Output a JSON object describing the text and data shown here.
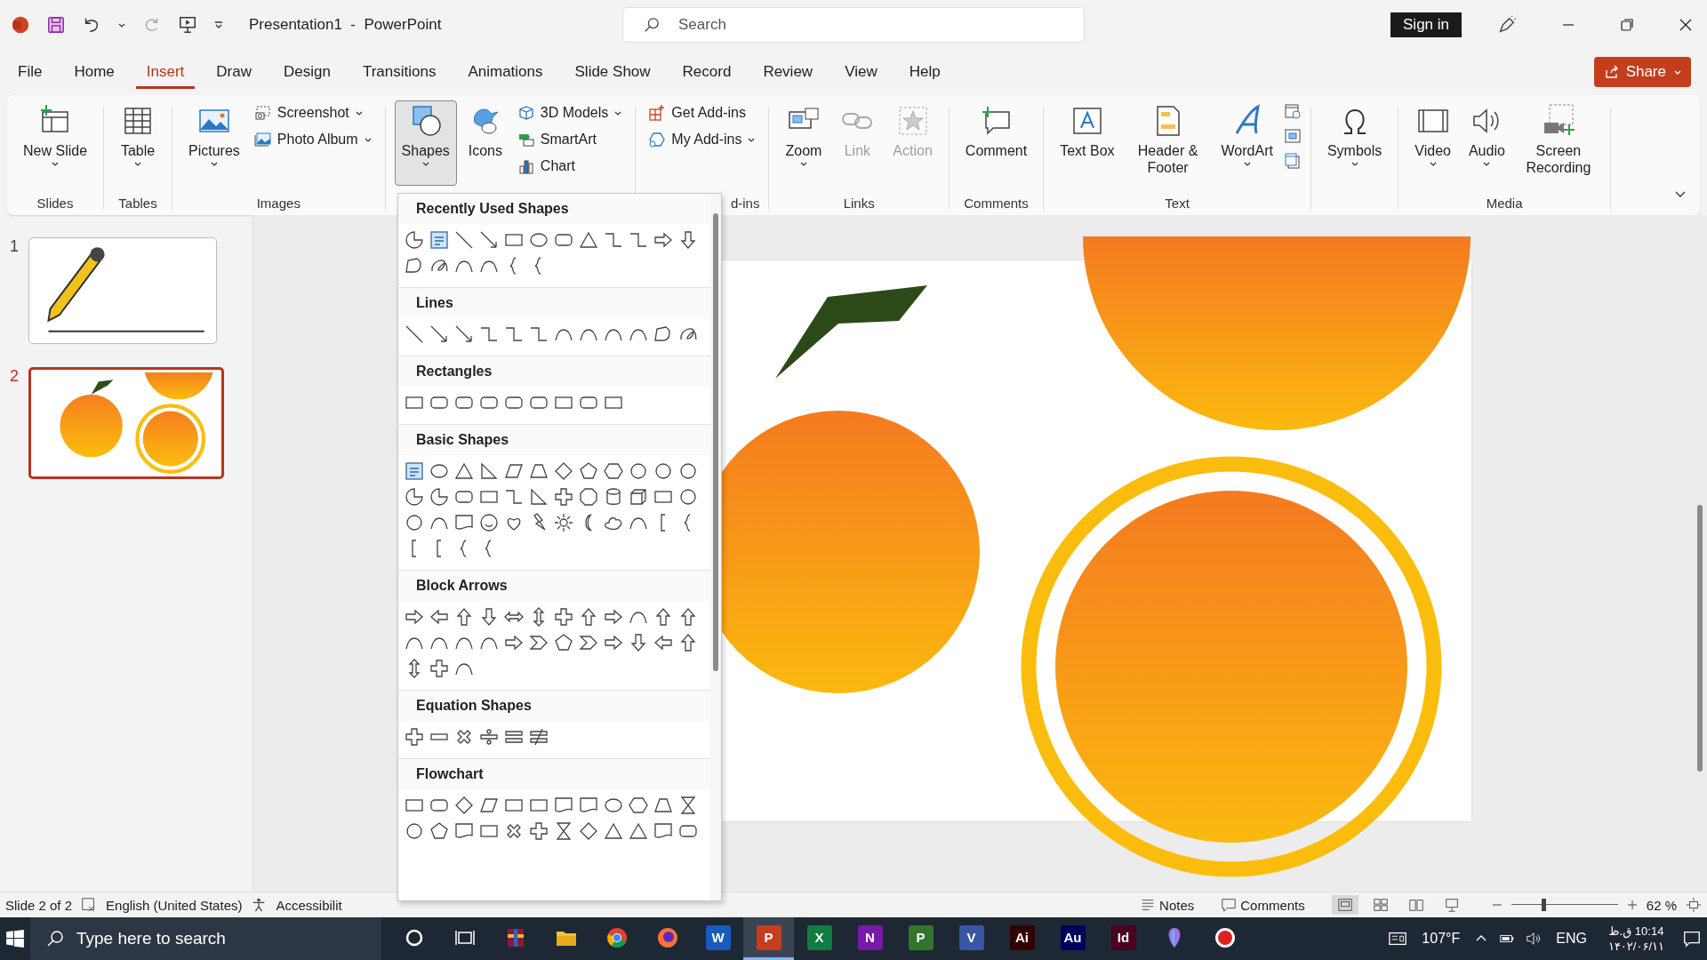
{
  "title_bar": {
    "title": "Presentation1  -  PowerPoint",
    "search_placeholder": "Search",
    "sign_in": "Sign in"
  },
  "tabs": [
    {
      "label": "File",
      "selected": false
    },
    {
      "label": "Home",
      "selected": false
    },
    {
      "label": "Insert",
      "selected": true
    },
    {
      "label": "Draw",
      "selected": false
    },
    {
      "label": "Design",
      "selected": false
    },
    {
      "label": "Transitions",
      "selected": false
    },
    {
      "label": "Animations",
      "selected": false
    },
    {
      "label": "Slide Show",
      "selected": false
    },
    {
      "label": "Record",
      "selected": false
    },
    {
      "label": "Review",
      "selected": false
    },
    {
      "label": "View",
      "selected": false
    },
    {
      "label": "Help",
      "selected": false
    }
  ],
  "share": "Share",
  "ribbon": {
    "groups": [
      {
        "label": "Slides",
        "items": [
          {
            "kind": "large",
            "label": "New Slide",
            "dropdown": true,
            "disabled": false,
            "expanded": false
          }
        ]
      },
      {
        "label": "Tables",
        "items": [
          {
            "kind": "large",
            "label": "Table",
            "dropdown": true,
            "disabled": false,
            "expanded": false
          }
        ]
      },
      {
        "label": "Images",
        "items": [
          {
            "kind": "large",
            "label": "Pictures",
            "dropdown": true,
            "disabled": false,
            "expanded": false
          },
          {
            "kind": "stack",
            "items": [
              {
                "label": "Screenshot",
                "dropdown": true
              },
              {
                "label": "Photo Album",
                "dropdown": true
              }
            ]
          }
        ]
      },
      {
        "items": [
          {
            "kind": "large",
            "label": "Shapes",
            "dropdown": true,
            "disabled": false,
            "expanded": true
          },
          {
            "kind": "large",
            "label": "Icons",
            "dropdown": false,
            "disabled": false,
            "expanded": false
          },
          {
            "kind": "stack",
            "items": [
              {
                "label": "3D Models",
                "dropdown": true
              },
              {
                "label": "SmartArt",
                "dropdown": false
              },
              {
                "label": "Chart",
                "dropdown": false
              }
            ]
          }
        ]
      },
      {
        "label": "d-ins",
        "items": [
          {
            "kind": "stack",
            "items": [
              {
                "label": "Get Add-ins",
                "dropdown": false
              },
              {
                "label": "My Add-ins",
                "dropdown": true
              }
            ]
          }
        ]
      },
      {
        "label": "Links",
        "items": [
          {
            "kind": "large",
            "label": "Zoom",
            "dropdown": true,
            "disabled": false,
            "expanded": false
          },
          {
            "kind": "large",
            "label": "Link",
            "dropdown": false,
            "disabled": true,
            "expanded": false
          },
          {
            "kind": "large",
            "label": "Action",
            "dropdown": false,
            "disabled": true,
            "expanded": false
          }
        ]
      },
      {
        "label": "Comments",
        "items": [
          {
            "kind": "large",
            "label": "Comment",
            "dropdown": false,
            "disabled": false,
            "expanded": false
          }
        ]
      },
      {
        "label": "Text",
        "items": [
          {
            "kind": "large",
            "label": "Text Box",
            "dropdown": false,
            "disabled": false,
            "expanded": false
          },
          {
            "kind": "large",
            "label": "Header & Footer",
            "dropdown": false,
            "disabled": false,
            "expanded": false
          },
          {
            "kind": "large",
            "label": "WordArt",
            "dropdown": true,
            "disabled": false,
            "expanded": false
          },
          {
            "kind": "icons"
          }
        ]
      },
      {
        "items": [
          {
            "kind": "large",
            "label": "Symbols",
            "dropdown": true,
            "disabled": false,
            "expanded": false
          }
        ]
      },
      {
        "label": "Media",
        "items": [
          {
            "kind": "large",
            "label": "Video",
            "dropdown": true,
            "disabled": false,
            "expanded": false
          },
          {
            "kind": "large",
            "label": "Audio",
            "dropdown": true,
            "disabled": false,
            "expanded": false
          },
          {
            "kind": "large",
            "label": "Screen Recording",
            "dropdown": false,
            "disabled": false,
            "expanded": false
          }
        ]
      }
    ]
  },
  "shapes_gallery": {
    "sections": [
      {
        "title": "Recently Used Shapes",
        "shapes": [
          {
            "kind": "pie"
          },
          {
            "kind": "textbox"
          },
          {
            "kind": "line"
          },
          {
            "kind": "arrowline"
          },
          {
            "kind": "rect"
          },
          {
            "kind": "oval"
          },
          {
            "kind": "round"
          },
          {
            "kind": "tri"
          },
          {
            "kind": "elbow"
          },
          {
            "kind": "elbow"
          },
          {
            "kind": "arrowR"
          },
          {
            "kind": "arrowD"
          },
          {
            "kind": "freeform"
          },
          {
            "kind": "scribble"
          },
          {
            "kind": "curve"
          },
          {
            "kind": "curve"
          },
          {
            "kind": "brace"
          },
          {
            "kind": "brace"
          }
        ]
      },
      {
        "title": "Lines",
        "shapes": [
          {
            "kind": "line"
          },
          {
            "kind": "arrowline"
          },
          {
            "kind": "arrowline"
          },
          {
            "kind": "elbow"
          },
          {
            "kind": "elbow"
          },
          {
            "kind": "elbow"
          },
          {
            "kind": "curve"
          },
          {
            "kind": "curve"
          },
          {
            "kind": "curve"
          },
          {
            "kind": "curve"
          },
          {
            "kind": "freeform"
          },
          {
            "kind": "scribble"
          }
        ]
      },
      {
        "title": "Rectangles",
        "shapes": [
          {
            "kind": "rect"
          },
          {
            "kind": "round"
          },
          {
            "kind": "round"
          },
          {
            "kind": "round"
          },
          {
            "kind": "round"
          },
          {
            "kind": "round"
          },
          {
            "kind": "rect"
          },
          {
            "kind": "round"
          },
          {
            "kind": "rect"
          }
        ]
      },
      {
        "title": "Basic Shapes",
        "shapes": [
          {
            "kind": "textbox"
          },
          {
            "kind": "oval"
          },
          {
            "kind": "tri"
          },
          {
            "kind": "rtri"
          },
          {
            "kind": "para"
          },
          {
            "kind": "trap"
          },
          {
            "kind": "diamond"
          },
          {
            "kind": "pent"
          },
          {
            "kind": "hex"
          },
          {
            "kind": "circ"
          },
          {
            "kind": "circ"
          },
          {
            "kind": "circ"
          },
          {
            "kind": "pie"
          },
          {
            "kind": "pie"
          },
          {
            "kind": "round"
          },
          {
            "kind": "rect"
          },
          {
            "kind": "elbow"
          },
          {
            "kind": "rtri"
          },
          {
            "kind": "plus"
          },
          {
            "kind": "oct"
          },
          {
            "kind": "can"
          },
          {
            "kind": "cube"
          },
          {
            "kind": "rect"
          },
          {
            "kind": "circ"
          },
          {
            "kind": "circ"
          },
          {
            "kind": "curve"
          },
          {
            "kind": "doc"
          },
          {
            "kind": "smile"
          },
          {
            "kind": "heart"
          },
          {
            "kind": "bolt"
          },
          {
            "kind": "sun"
          },
          {
            "kind": "moon"
          },
          {
            "kind": "cloud"
          },
          {
            "kind": "curve"
          },
          {
            "kind": "bracket"
          },
          {
            "kind": "brace"
          },
          {
            "kind": "bracket"
          },
          {
            "kind": "bracket"
          },
          {
            "kind": "brace"
          },
          {
            "kind": "brace"
          }
        ]
      },
      {
        "title": "Block Arrows",
        "shapes": [
          {
            "kind": "arrowR"
          },
          {
            "kind": "arrowL"
          },
          {
            "kind": "arrowU"
          },
          {
            "kind": "arrowD"
          },
          {
            "kind": "arrowLR"
          },
          {
            "kind": "arrowUD"
          },
          {
            "kind": "plus"
          },
          {
            "kind": "arrowU"
          },
          {
            "kind": "arrowR"
          },
          {
            "kind": "curve"
          },
          {
            "kind": "arrowU"
          },
          {
            "kind": "arrowU"
          },
          {
            "kind": "curve"
          },
          {
            "kind": "curve"
          },
          {
            "kind": "curve"
          },
          {
            "kind": "curve"
          },
          {
            "kind": "arrowR"
          },
          {
            "kind": "chevron"
          },
          {
            "kind": "pent"
          },
          {
            "kind": "chevron"
          },
          {
            "kind": "arrowR"
          },
          {
            "kind": "arrowD"
          },
          {
            "kind": "arrowL"
          },
          {
            "kind": "arrowU"
          },
          {
            "kind": "arrowUD"
          },
          {
            "kind": "plus"
          },
          {
            "kind": "curve"
          }
        ]
      },
      {
        "title": "Equation Shapes",
        "shapes": [
          {
            "kind": "plus"
          },
          {
            "kind": "minus"
          },
          {
            "kind": "mult"
          },
          {
            "kind": "div"
          },
          {
            "kind": "equal"
          },
          {
            "kind": "neq"
          }
        ]
      },
      {
        "title": "Flowchart",
        "shapes": [
          {
            "kind": "rect"
          },
          {
            "kind": "round"
          },
          {
            "kind": "diamond"
          },
          {
            "kind": "para"
          },
          {
            "kind": "rect"
          },
          {
            "kind": "rect"
          },
          {
            "kind": "doc"
          },
          {
            "kind": "doc"
          },
          {
            "kind": "oval"
          },
          {
            "kind": "hex"
          },
          {
            "kind": "trap"
          },
          {
            "kind": "hourglass"
          },
          {
            "kind": "circ"
          },
          {
            "kind": "pent"
          },
          {
            "kind": "doc"
          },
          {
            "kind": "rect"
          },
          {
            "kind": "mult"
          },
          {
            "kind": "plus"
          },
          {
            "kind": "hourglass"
          },
          {
            "kind": "diamond"
          },
          {
            "kind": "tri"
          },
          {
            "kind": "tri"
          },
          {
            "kind": "doc"
          },
          {
            "kind": "round"
          }
        ]
      }
    ]
  },
  "slides": [
    {
      "number": "1",
      "kind": "pencil",
      "selected": false
    },
    {
      "number": "2",
      "kind": "oranges",
      "selected": true
    }
  ],
  "status_bar": {
    "slide": "Slide 2 of 2",
    "language": "English (United States)",
    "accessibility": "Accessibilit",
    "notes": "Notes",
    "comments": "Comments",
    "views": [
      {
        "kind": "normal",
        "selected": true
      },
      {
        "kind": "sorter",
        "selected": false
      },
      {
        "kind": "reading",
        "selected": false
      },
      {
        "kind": "slideshow",
        "selected": false
      }
    ],
    "zoom": {
      "level": 0.3,
      "reading": "62 %"
    }
  },
  "taskbar": {
    "search_placeholder": "Type here to search",
    "apps": [
      {
        "kind": "ring",
        "selected": false
      },
      {
        "kind": "taskview",
        "selected": false
      },
      {
        "kind": "archive",
        "selected": false
      },
      {
        "kind": "folder",
        "selected": false
      },
      {
        "kind": "chrome",
        "selected": false
      },
      {
        "kind": "firefox",
        "selected": false
      },
      {
        "kind": "letter",
        "label": "W",
        "color": "#185abd",
        "selected": false
      },
      {
        "kind": "letter",
        "label": "P",
        "color": "#c43e1c",
        "selected": true
      },
      {
        "kind": "letter",
        "label": "X",
        "color": "#107c41",
        "selected": false
      },
      {
        "kind": "letter",
        "label": "N",
        "color": "#7719aa",
        "selected": false
      },
      {
        "kind": "letter",
        "label": "P",
        "color": "#31752f",
        "selected": false
      },
      {
        "kind": "letter",
        "label": "V",
        "color": "#3955a3",
        "selected": false
      },
      {
        "kind": "letter",
        "label": "Ai",
        "color": "#330000",
        "selected": false
      },
      {
        "kind": "letter",
        "label": "Au",
        "color": "#00005b",
        "selected": false
      },
      {
        "kind": "letter",
        "label": "Id",
        "color": "#49021f",
        "selected": false
      },
      {
        "kind": "balloon",
        "selected": false
      },
      {
        "kind": "record",
        "selected": false
      }
    ],
    "weather": "107°F",
    "language": "ENG",
    "time": "10:14 ق.ظ",
    "date": "۱۴۰۲/۰۶/۱۱"
  }
}
